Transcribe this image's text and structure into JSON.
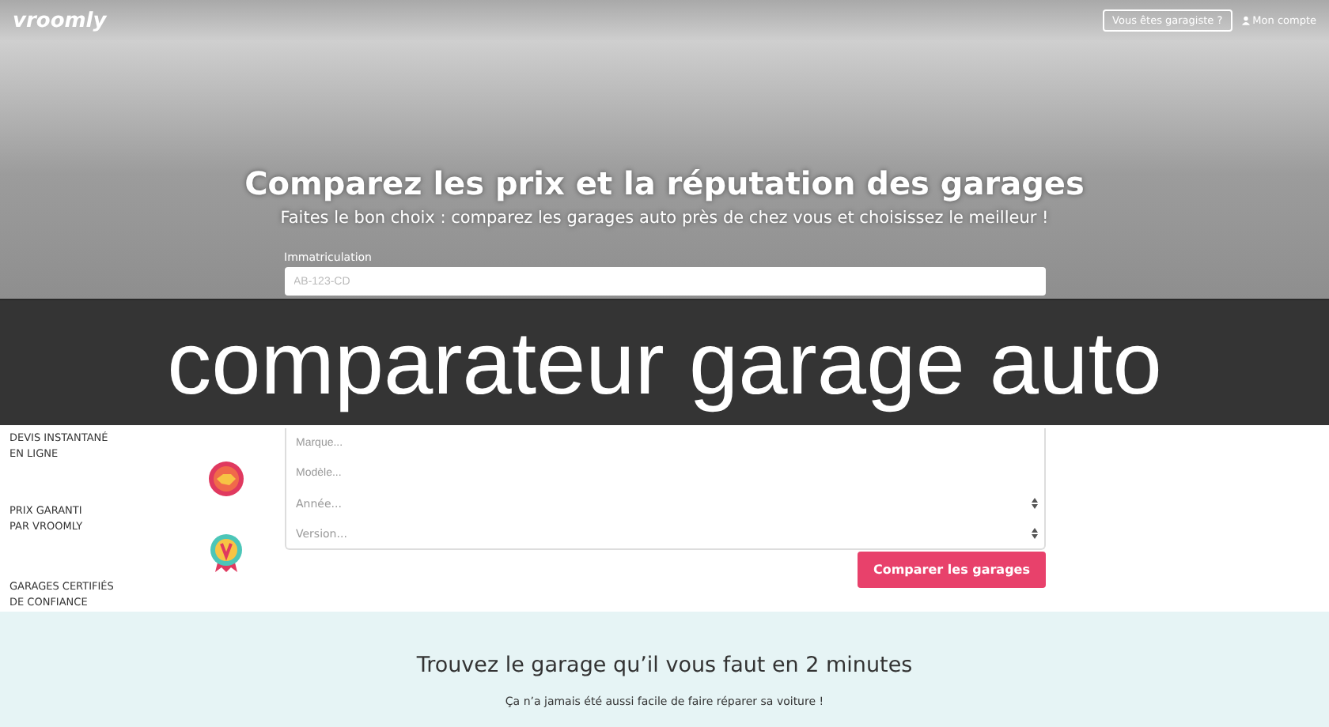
{
  "nav": {
    "logo": "vroomly",
    "links": [
      {
        "label": "Vous êtes garagiste ?",
        "kind": "outline"
      },
      {
        "label": "Mon compte",
        "kind": "account"
      }
    ]
  },
  "hero": {
    "title": "Comparez les prix et la réputation des garages",
    "subtitle": "Faites le bon choix : comparez les garages auto près de chez vous et choisissez le meilleur !",
    "plate_label": "Immatriculation",
    "plate_placeholder": "AB-123-CD"
  },
  "features": [
    {
      "lines": [
        "DEVIS INSTANTANÉ",
        "EN LIGNE"
      ]
    },
    {
      "lines": [
        "PRIX GARANTI",
        "PAR VROOMLY"
      ]
    },
    {
      "lines": [
        "GARAGES CERTIFIÉS",
        "DE CONFIANCE"
      ]
    }
  ],
  "fields": [
    {
      "placeholder": "Marque...",
      "kind": "input"
    },
    {
      "placeholder": "Modèle...",
      "kind": "input"
    },
    {
      "placeholder": "Année...",
      "kind": "select"
    },
    {
      "placeholder": "Version...",
      "kind": "select"
    }
  ],
  "submit": "Comparer les garages",
  "section": {
    "title": "Trouvez le garage qu’il vous faut en 2 minutes",
    "subtitle": "Ça n’a jamais été aussi facile de faire réparer sa voiture !"
  },
  "banner": "comparateur garage auto"
}
